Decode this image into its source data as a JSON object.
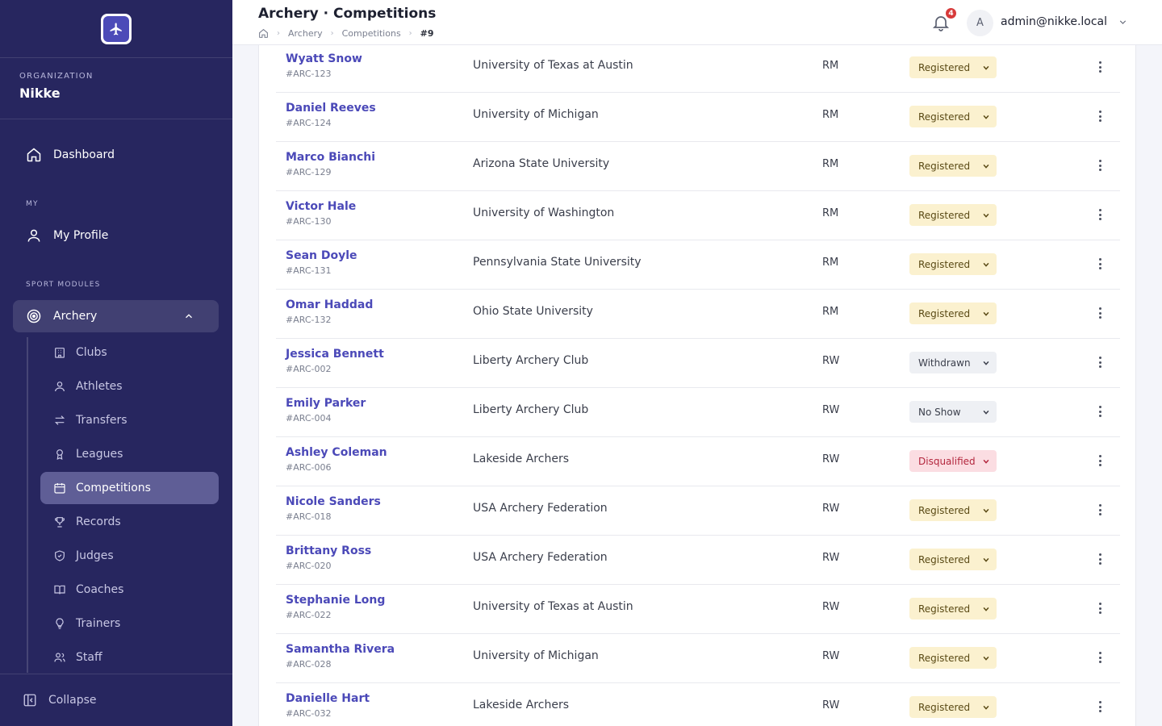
{
  "sidebar": {
    "org_label": "ORGANIZATION",
    "org_name": "Nikke",
    "dashboard": "Dashboard",
    "my_label": "MY",
    "my_profile": "My Profile",
    "modules_label": "SPORT MODULES",
    "archery": "Archery",
    "sub_items": [
      "Clubs",
      "Athletes",
      "Transfers",
      "Leagues",
      "Competitions",
      "Records",
      "Judges",
      "Coaches",
      "Trainers",
      "Staff"
    ],
    "active_item": "Competitions",
    "collapse": "Collapse"
  },
  "header": {
    "title": "Archery · Competitions",
    "breadcrumb": [
      "Archery",
      "Competitions",
      "#9"
    ],
    "notification_count": "4",
    "avatar_initial": "A",
    "user_email": "admin@nikke.local"
  },
  "table": {
    "rows": [
      {
        "name": "Wyatt Snow",
        "code": "#ARC-123",
        "club": "University of Texas at Austin",
        "category": "RM",
        "status": "Registered"
      },
      {
        "name": "Daniel Reeves",
        "code": "#ARC-124",
        "club": "University of Michigan",
        "category": "RM",
        "status": "Registered"
      },
      {
        "name": "Marco Bianchi",
        "code": "#ARC-129",
        "club": "Arizona State University",
        "category": "RM",
        "status": "Registered"
      },
      {
        "name": "Victor Hale",
        "code": "#ARC-130",
        "club": "University of Washington",
        "category": "RM",
        "status": "Registered"
      },
      {
        "name": "Sean Doyle",
        "code": "#ARC-131",
        "club": "Pennsylvania State University",
        "category": "RM",
        "status": "Registered"
      },
      {
        "name": "Omar Haddad",
        "code": "#ARC-132",
        "club": "Ohio State University",
        "category": "RM",
        "status": "Registered"
      },
      {
        "name": "Jessica Bennett",
        "code": "#ARC-002",
        "club": "Liberty Archery Club",
        "category": "RW",
        "status": "Withdrawn"
      },
      {
        "name": "Emily Parker",
        "code": "#ARC-004",
        "club": "Liberty Archery Club",
        "category": "RW",
        "status": "No Show"
      },
      {
        "name": "Ashley Coleman",
        "code": "#ARC-006",
        "club": "Lakeside Archers",
        "category": "RW",
        "status": "Disqualified"
      },
      {
        "name": "Nicole Sanders",
        "code": "#ARC-018",
        "club": "USA Archery Federation",
        "category": "RW",
        "status": "Registered"
      },
      {
        "name": "Brittany Ross",
        "code": "#ARC-020",
        "club": "USA Archery Federation",
        "category": "RW",
        "status": "Registered"
      },
      {
        "name": "Stephanie Long",
        "code": "#ARC-022",
        "club": "University of Texas at Austin",
        "category": "RW",
        "status": "Registered"
      },
      {
        "name": "Samantha Rivera",
        "code": "#ARC-028",
        "club": "University of Michigan",
        "category": "RW",
        "status": "Registered"
      },
      {
        "name": "Danielle Hart",
        "code": "#ARC-032",
        "club": "Lakeside Archers",
        "category": "RW",
        "status": "Registered"
      }
    ]
  },
  "colors": {
    "sidebar_bg": "#27265f",
    "accent": "#4b49b8",
    "registered_bg": "#fbf1cf",
    "disqualified_bg": "#fbdde2",
    "badge": "#d73a3a"
  }
}
